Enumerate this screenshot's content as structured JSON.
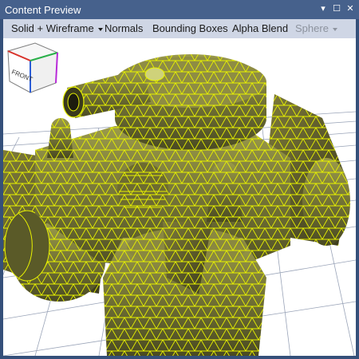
{
  "window": {
    "title": "Content Preview",
    "controls": {
      "dropdown": "▾",
      "maximize": "☐",
      "close": "✕"
    }
  },
  "toolbar": {
    "items": [
      {
        "label": "Solid + Wireframe",
        "has_dropdown": true,
        "enabled": true
      },
      {
        "label": "Normals",
        "has_dropdown": false,
        "enabled": true
      },
      {
        "label": "Bounding Boxes",
        "has_dropdown": false,
        "enabled": true
      },
      {
        "label": "Alpha Blend",
        "has_dropdown": false,
        "enabled": true
      },
      {
        "label": "Sphere",
        "has_dropdown": true,
        "enabled": false
      }
    ]
  },
  "viewport": {
    "model": "tank",
    "wire_color": "#e8f200",
    "grid_color": "#9aa4b8"
  },
  "view_cube": {
    "face_label": "FRONT"
  },
  "colors": {
    "title_bar": "#46618c",
    "frame": "#35507a",
    "toolbar": "#cfd6e5"
  }
}
